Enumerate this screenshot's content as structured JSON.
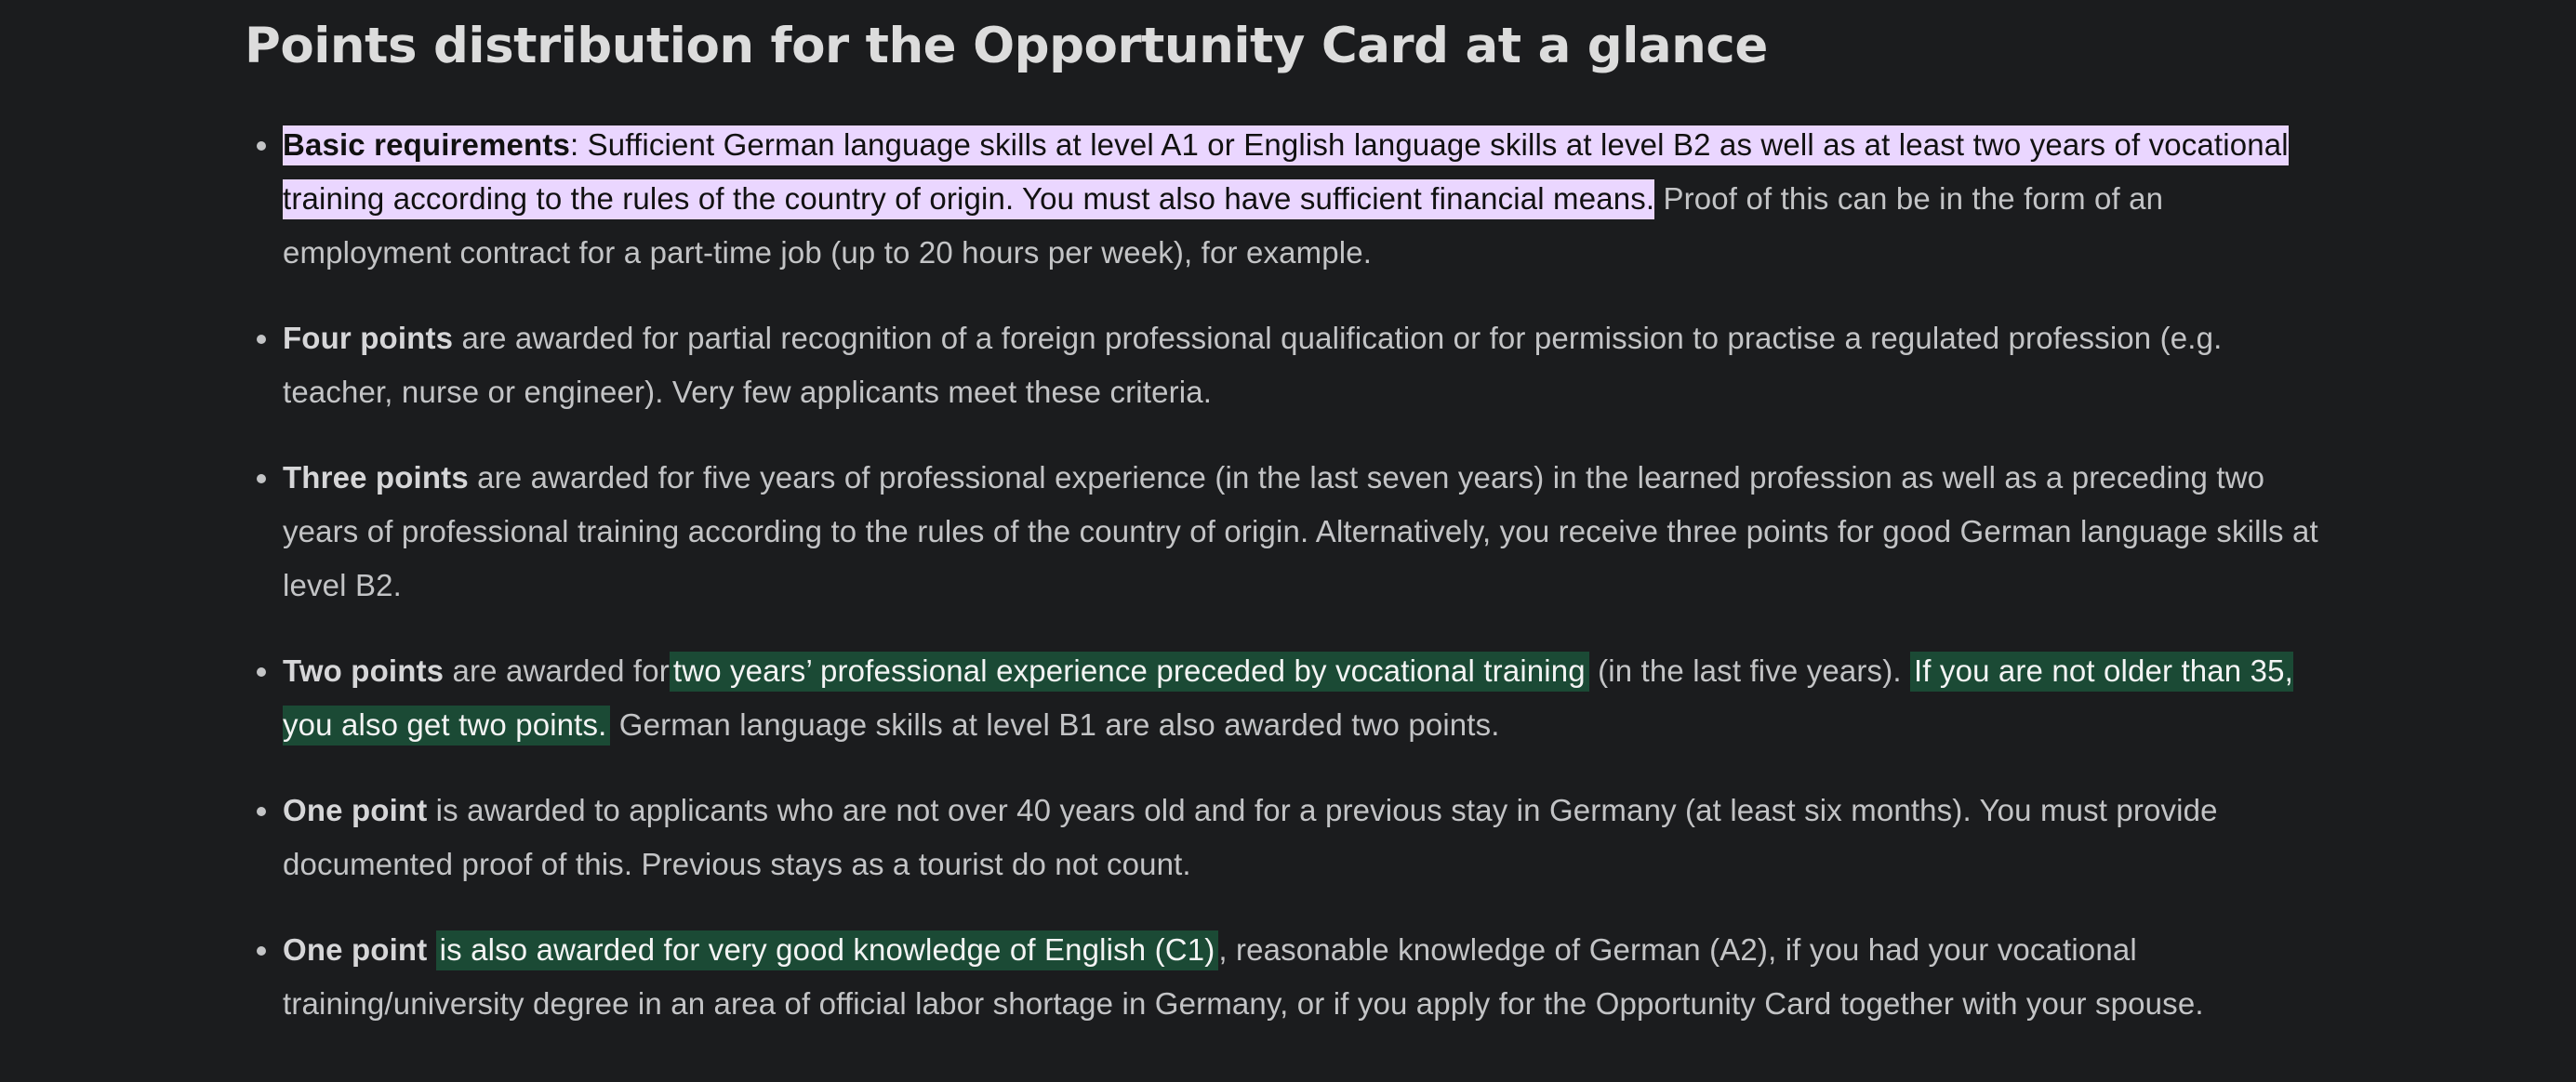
{
  "heading": "Points distribution for the Opportunity Card at a glance",
  "items": [
    {
      "bold": "Basic requirements",
      "highlight_rest": ": Sufficient German language skills at level A1 or English language skills at level B2 as well as at least two years of vocational training according to the rules of the country of origin. You must also have sufficient financial means.",
      "text_after": " Proof of this can be in the form of an employment contract for a part-time job (up to 20 hours per week), for example."
    },
    {
      "bold": "Four points",
      "text": " are awarded for partial recognition of a foreign professional qualification or for permission to practise a regulated profession (e.g. teacher, nurse or engineer). Very few applicants meet these criteria."
    },
    {
      "bold": "Three points",
      "text": " are awarded for five years of professional experience (in the last seven years) in the learned profession as well as a preceding two years of professional training according to the rules of the country of origin. Alternatively, you receive three points for good German language skills at level B2."
    },
    {
      "bold": "Two points",
      "text_1": " are awarded for",
      "highlight_1": "two years’ professional experience preceded by vocational training",
      "text_2": " (in the last five years). ",
      "highlight_2": "If you are not older than 35, you also get two points.",
      "text_3": " German language skills at level B1 are also awarded two points."
    },
    {
      "bold": "One point",
      "text": " is awarded to applicants who are not over 40 years old and for a previous stay in Germany (at least six months). You must provide documented proof of this. Previous stays as a tourist do not count."
    },
    {
      "bold": "One point",
      "highlight": "is also awarded for very good knowledge of English (C1)",
      "text": ", reasonable knowledge of German (A2), if you had your vocational training/university degree in an area of official labor shortage in Germany, or if you apply for the Opportunity Card together with your spouse."
    }
  ],
  "colors": {
    "background": "#1b1c1e",
    "text": "#c3c4c6",
    "heading": "#dcdcdc",
    "highlight_purple": "#ead6ff",
    "highlight_green": "#1b4a35"
  }
}
